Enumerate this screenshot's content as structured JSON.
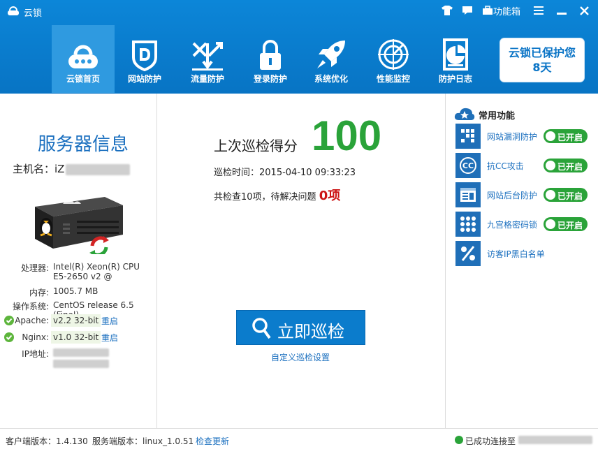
{
  "app": {
    "title": "云锁"
  },
  "titlebar": {
    "toolbox_label": "功能箱"
  },
  "nav": [
    {
      "label": "云锁首页",
      "icon": "cloud-lock-icon",
      "active": true
    },
    {
      "label": "网站防护",
      "icon": "shield-d-icon",
      "active": false
    },
    {
      "label": "流量防护",
      "icon": "traffic-icon",
      "active": false
    },
    {
      "label": "登录防护",
      "icon": "padlock-icon",
      "active": false
    },
    {
      "label": "系统优化",
      "icon": "rocket-icon",
      "active": false
    },
    {
      "label": "性能监控",
      "icon": "radar-icon",
      "active": false
    },
    {
      "label": "防护日志",
      "icon": "log-report-icon",
      "active": false
    }
  ],
  "protect": {
    "line1": "云锁已保护您",
    "line2": "8天"
  },
  "server": {
    "title": "服务器信息",
    "host_label": "主机名：",
    "host_value": "iZ",
    "cpu_label": "处理器:",
    "cpu_value_1": "Intel(R) Xeon(R) CPU",
    "cpu_value_2": "E5-2650 v2 @",
    "mem_label": "内存:",
    "mem_value": "1005.7 MB",
    "os_label": "操作系统:",
    "os_value": "CentOS release 6.5 (Final)",
    "apache_label": "Apache:",
    "apache_value": "v2.2 32-bit",
    "nginx_label": "Nginx:",
    "nginx_value": "v1.0 32-bit",
    "restart_label": "重启",
    "ip_label": "IP地址:"
  },
  "scan": {
    "score_label": "上次巡检得分",
    "score": "100",
    "time_text": "巡检时间：2015-04-10 09:33:23",
    "issue_prefix": "共检查10项，待解决问题",
    "issue_count": "0项",
    "button_label": "立即巡检",
    "custom_link": "自定义巡检设置"
  },
  "features": {
    "title": "常用功能",
    "items": [
      {
        "label": "网站漏洞防护",
        "status": "已开启",
        "icon": "bug-shield-icon"
      },
      {
        "label": "抗CC攻击",
        "status": "已开启",
        "icon": "cc-icon"
      },
      {
        "label": "网站后台防护",
        "status": "已开启",
        "icon": "admin-panel-icon"
      },
      {
        "label": "九宫格密码锁",
        "status": "已开启",
        "icon": "grid-lock-icon"
      },
      {
        "label": "访客IP黑白名单",
        "status": "",
        "icon": "percent-list-icon"
      }
    ]
  },
  "status": {
    "client_version": "客户端版本：1.4.130",
    "server_version": "服务端版本：linux_1.0.51",
    "check_update": "检查更新",
    "connected": "已成功连接至"
  },
  "colors": {
    "header_blue": "#0a7acb",
    "accent_green": "#2aa339",
    "link_blue": "#1a6fbf",
    "issue_red": "#cc1414"
  }
}
